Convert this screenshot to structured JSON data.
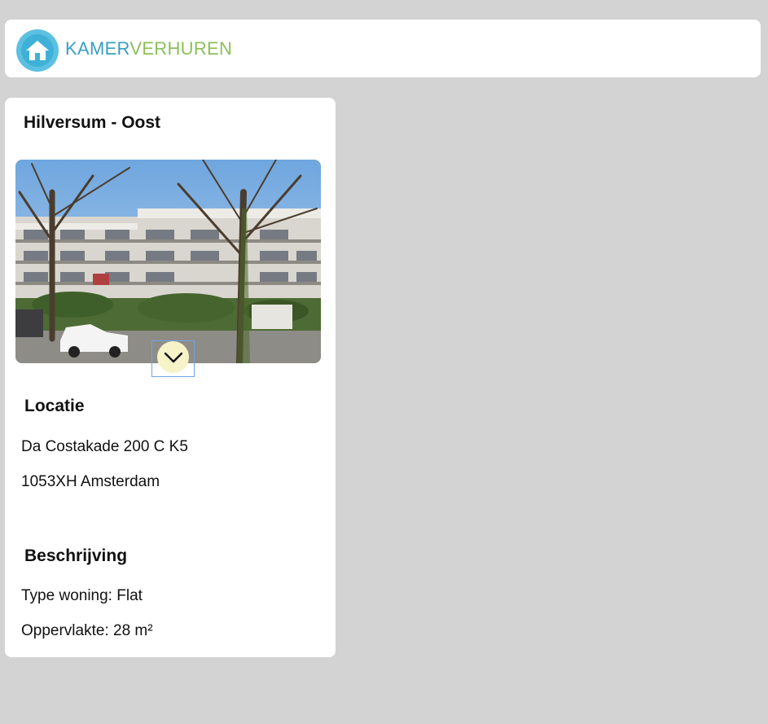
{
  "header": {
    "logo_part1": "KAMER",
    "logo_part2": "VERHUREN",
    "brand_colors": {
      "primary": "#3a9ec3",
      "secondary": "#8cbf5a"
    }
  },
  "listing": {
    "title": "Hilversum - Oost",
    "photo_alt": "apartment-building-photo",
    "expand_icon": "chevron-down-icon",
    "location": {
      "heading": "Locatie",
      "address_line1": "Da Costakade 200 C K5",
      "address_line2": "1053XH Amsterdam"
    },
    "description": {
      "heading": "Beschrijving",
      "type": "Type woning: Flat",
      "area": "Oppervlakte: 28 m²"
    }
  }
}
